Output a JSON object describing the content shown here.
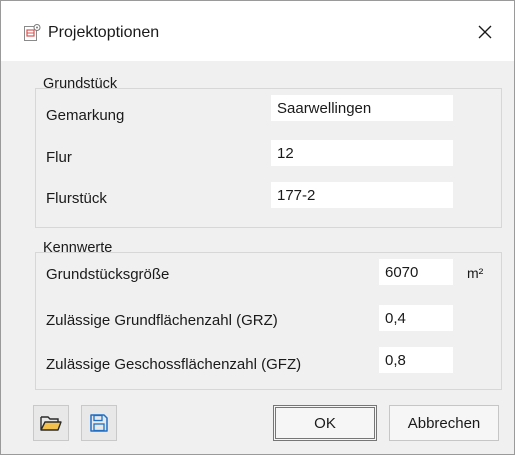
{
  "window": {
    "title": "Projektoptionen",
    "title_icon": "project-settings-icon",
    "close_icon": "close-icon"
  },
  "grundstueck": {
    "title": "Grundstück",
    "gemarkung": {
      "label": "Gemarkung",
      "value": "Saarwellingen"
    },
    "flur": {
      "label": "Flur",
      "value": "12"
    },
    "flurstueck": {
      "label": "Flurstück",
      "value": "177-2"
    }
  },
  "kennwerte": {
    "title": "Kennwerte",
    "groesse": {
      "label": "Grundstücksgröße",
      "value": "6070",
      "unit": "m²"
    },
    "grz": {
      "label": "Zulässige Grundflächenzahl (GRZ)",
      "value": "0,4"
    },
    "gfz": {
      "label": "Zulässige Geschossflächenzahl (GFZ)",
      "value": "0,8"
    }
  },
  "footer": {
    "open_icon": "folder-open-icon",
    "save_icon": "save-icon",
    "ok_label": "OK",
    "cancel_label": "Abbrechen"
  },
  "colors": {
    "open_icon": "#d7a21f",
    "save_icon": "#1f6fc7",
    "title_icon": "#d9534f"
  }
}
